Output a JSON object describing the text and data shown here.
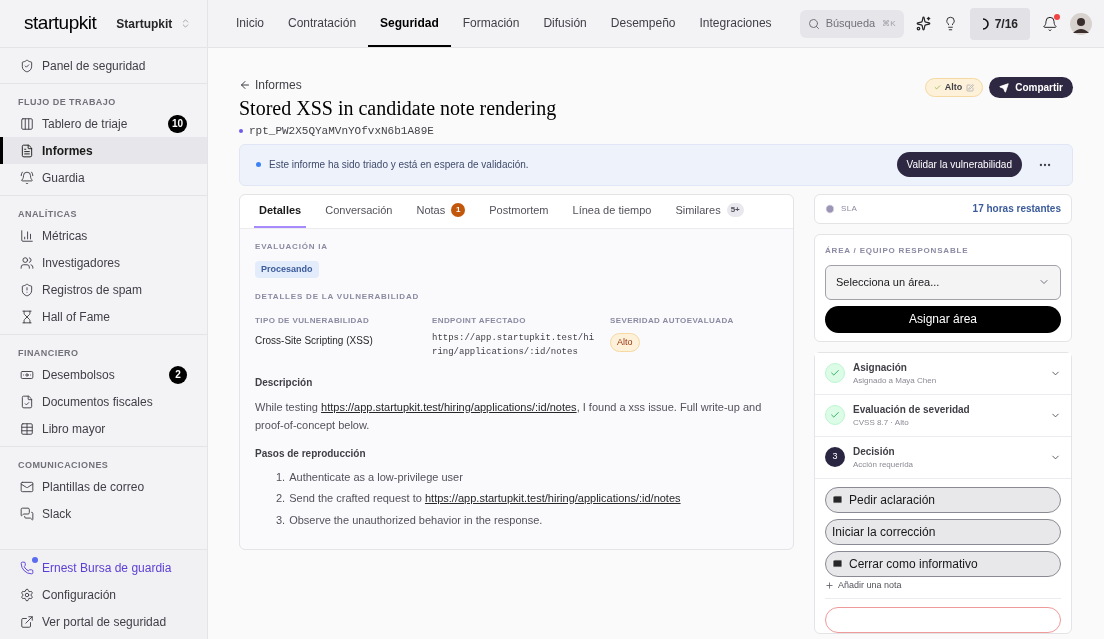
{
  "brand": {
    "logo": "startupkit",
    "workspace": "Startupkit"
  },
  "sidebar": {
    "sections": [
      {
        "items": [
          {
            "label": "Panel de seguridad",
            "selected": false
          }
        ]
      },
      {
        "title": "FLUJO DE TRABAJO",
        "items": [
          {
            "label": "Tablero de triaje",
            "badge": "10",
            "selected": false
          },
          {
            "label": "Informes",
            "selected": true
          },
          {
            "label": "Guardia",
            "selected": false
          }
        ]
      },
      {
        "title": "ANALÍTICAS",
        "items": [
          {
            "label": "Métricas",
            "selected": false
          },
          {
            "label": "Investigadores",
            "selected": false
          },
          {
            "label": "Registros de spam",
            "selected": false
          },
          {
            "label": "Hall of Fame",
            "selected": false
          }
        ]
      },
      {
        "title": "FINANCIERO",
        "items": [
          {
            "label": "Desembolsos",
            "badge": "2",
            "selected": false
          },
          {
            "label": "Documentos fiscales",
            "selected": false
          },
          {
            "label": "Libro mayor",
            "selected": false
          }
        ]
      },
      {
        "title": "COMUNICACIONES",
        "items": [
          {
            "label": "Plantillas de correo",
            "selected": false
          },
          {
            "label": "Slack",
            "selected": false
          }
        ]
      }
    ],
    "footer": [
      {
        "label": "Ernest Bursa de guardia",
        "kind": "oncall"
      },
      {
        "label": "Configuración",
        "kind": "link"
      },
      {
        "label": "Ver portal de seguridad",
        "kind": "link"
      }
    ]
  },
  "top_nav": {
    "tabs": [
      {
        "label": "Inicio",
        "selected": false
      },
      {
        "label": "Contratación",
        "selected": false
      },
      {
        "label": "Seguridad",
        "selected": true
      },
      {
        "label": "Formación",
        "selected": false
      },
      {
        "label": "Difusión",
        "selected": false
      },
      {
        "label": "Desempeño",
        "selected": false
      },
      {
        "label": "Integraciones",
        "selected": false
      }
    ],
    "search": {
      "placeholder": "Búsqueda",
      "shortcut": "⌘K"
    },
    "progress": "7/16",
    "notifications_unread": true
  },
  "header": {
    "back_link": "Informes",
    "title": "Stored XSS in candidate note rendering",
    "report_id": "rpt_PW2X5QYaMVnYOfvxN6b1A89E",
    "severity": "Alto",
    "share": "Compartir"
  },
  "banner": {
    "text": "Este informe ha sido triado y está en espera de validación.",
    "action": "Validar la vulnerabilidad"
  },
  "tabs": [
    {
      "label": "Detalles",
      "selected": true
    },
    {
      "label": "Conversación",
      "selected": false
    },
    {
      "label": "Notas",
      "badge": {
        "text": "1",
        "color": "#c2570c"
      },
      "selected": false
    },
    {
      "label": "Postmortem",
      "selected": false
    },
    {
      "label": "Línea de tiempo",
      "selected": false
    },
    {
      "label": "Similares",
      "badge": {
        "text": "5+",
        "color": "#e9e8ee"
      },
      "selected": false
    }
  ],
  "details": {
    "ai_title": "EVALUACIÓN IA",
    "ai_status": "Procesando",
    "vuln_title": "DETALLES DE LA VULNERABILIDAD",
    "fields": [
      {
        "label": "TIPO DE VULNERABILIDAD",
        "value": "Cross-Site Scripting (XSS)",
        "kind": "text"
      },
      {
        "label": "ENDPOINT AFECTADO",
        "value": "https://app.startupkit.test/hiring/applications/:id/notes",
        "kind": "code"
      },
      {
        "label": "SEVERIDAD AUTOEVALUADA",
        "value": "Alto",
        "kind": "badge"
      }
    ],
    "description_title": "Descripción",
    "description": {
      "before": "While testing ",
      "link": "https://app.startupkit.test/hiring/applications/:id/notes",
      "after": ", I found a xss issue. Full write-up and proof-of-concept below."
    },
    "steps_title": "Pasos de reproducción",
    "steps": [
      {
        "number": "1.",
        "text": "Authenticate as a low-privilege user"
      },
      {
        "number": "2.",
        "text": "Send the crafted request to ",
        "link": "https://app.startupkit.test/hiring/applications/:id/notes"
      },
      {
        "number": "3.",
        "text": "Observe the unauthorized behavior in the response."
      }
    ]
  },
  "sla": {
    "label": "SLA",
    "value": "17 horas restantes"
  },
  "area": {
    "label": "ÁREA / EQUIPO RESPONSABLE",
    "placeholder": "Selecciona un área...",
    "button": "Asignar área"
  },
  "workflow": [
    {
      "title": "Asignación",
      "subtitle": "Asignado a Maya Chen",
      "done": true
    },
    {
      "title": "Evaluación de severidad",
      "subtitle": "CVSS 8.7 · Alto",
      "done": true
    },
    {
      "title": "Decisión",
      "subtitle": "Acción requerida",
      "done": false,
      "number": "3"
    }
  ],
  "actions": [
    {
      "label": "Pedir aclaración",
      "kind": "mail"
    },
    {
      "label": "Iniciar la corrección",
      "kind": "plain"
    },
    {
      "label": "Cerrar como informativo",
      "kind": "mail"
    }
  ],
  "add_note": "Añadir una nota"
}
